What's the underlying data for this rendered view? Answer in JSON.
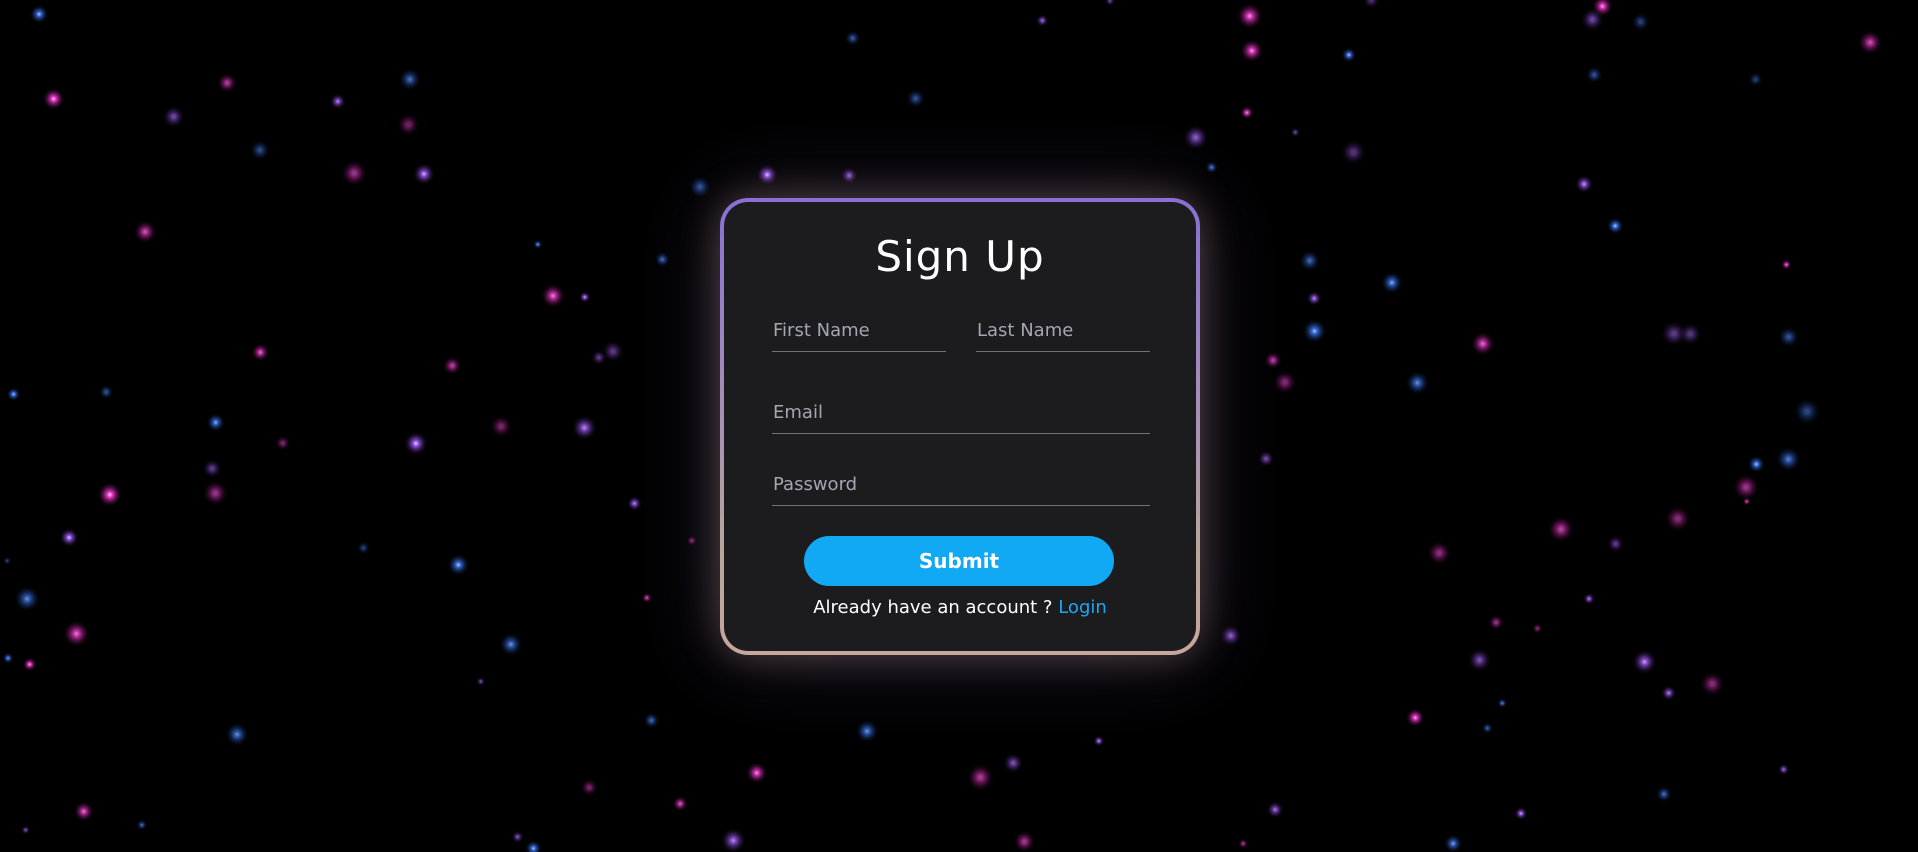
{
  "page": {
    "background_color": "#000000"
  },
  "form": {
    "title": "Sign Up",
    "fields": {
      "first_name": {
        "placeholder": "First Name",
        "value": ""
      },
      "last_name": {
        "placeholder": "Last Name",
        "value": ""
      },
      "email": {
        "placeholder": "Email",
        "value": ""
      },
      "password": {
        "placeholder": "Password",
        "value": ""
      }
    },
    "submit_label": "Submit",
    "footer": {
      "prompt": "Already have an account ?",
      "link_label": "Login"
    }
  },
  "colors": {
    "card_background": "#1c1c1f",
    "border_gradient_top": "#8a6fd6",
    "border_gradient_bottom": "#c8a79c",
    "accent": "#11a9f3",
    "link": "#1da7f0",
    "star_magenta": "#ff3ad9",
    "star_blue": "#3f7dff",
    "star_violet": "#a45cff"
  },
  "icons": {
    "background": "starfield-particles"
  }
}
